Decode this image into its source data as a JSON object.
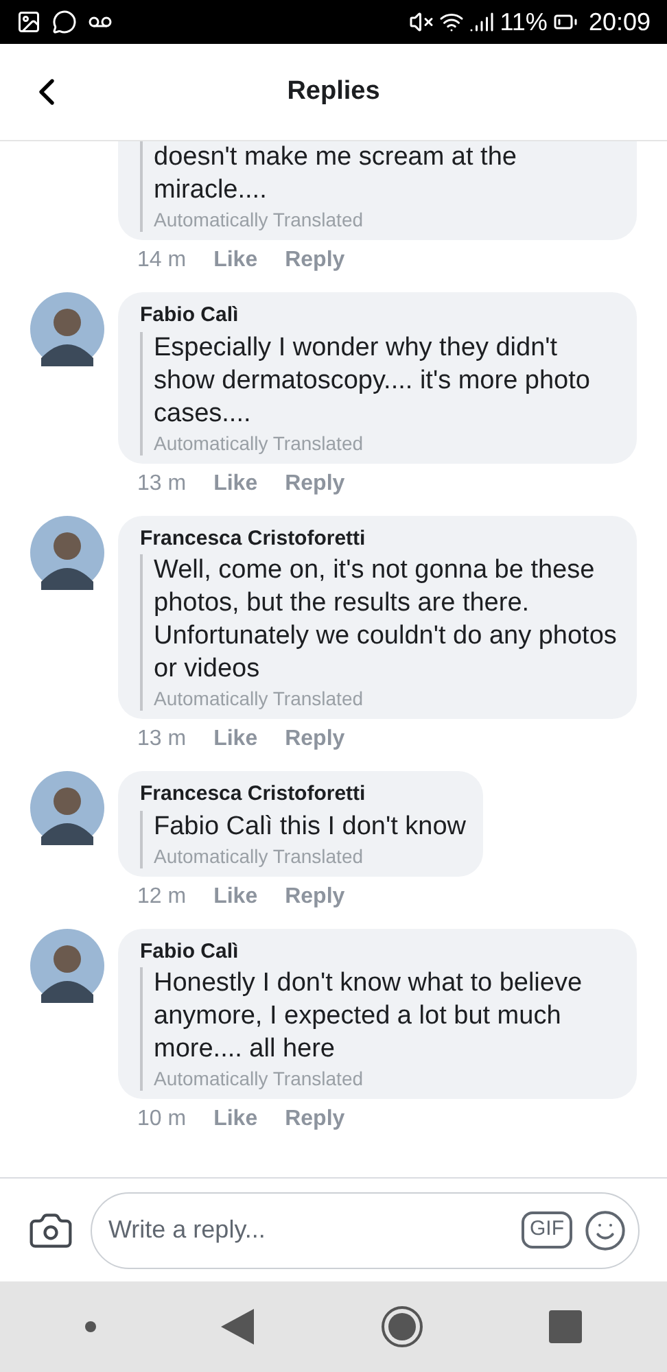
{
  "status_bar": {
    "battery": "11%",
    "time": "20:09"
  },
  "header": {
    "title": "Replies"
  },
  "comments": [
    {
      "lines": "doesn't make me scream at the miracle....",
      "translation": "Automatically Translated",
      "time": "14 m",
      "like": "Like",
      "reply": "Reply"
    },
    {
      "author": "Fabio Calì",
      "text": "Especially I wonder why they didn't show dermatoscopy.... it's more photo cases....",
      "translation": "Automatically Translated",
      "time": "13 m",
      "like": "Like",
      "reply": "Reply"
    },
    {
      "author": "Francesca Cristoforetti",
      "text": "Well, come on, it's not gonna be these photos, but the results are there. Unfortunately we couldn't do any photos or videos",
      "translation": "Automatically Translated",
      "time": "13 m",
      "like": "Like",
      "reply": "Reply"
    },
    {
      "author": "Francesca Cristoforetti",
      "text": "Fabio Calì this I don't know",
      "translation": "Automatically Translated",
      "time": "12 m",
      "like": "Like",
      "reply": "Reply"
    },
    {
      "author": "Fabio Calì",
      "text": "Honestly I don't know what to believe anymore, I expected a lot but much more.... all here",
      "translation": "Automatically Translated",
      "time": "10 m",
      "like": "Like",
      "reply": "Reply"
    }
  ],
  "composer": {
    "placeholder": "Write a reply...",
    "gif": "GIF"
  }
}
